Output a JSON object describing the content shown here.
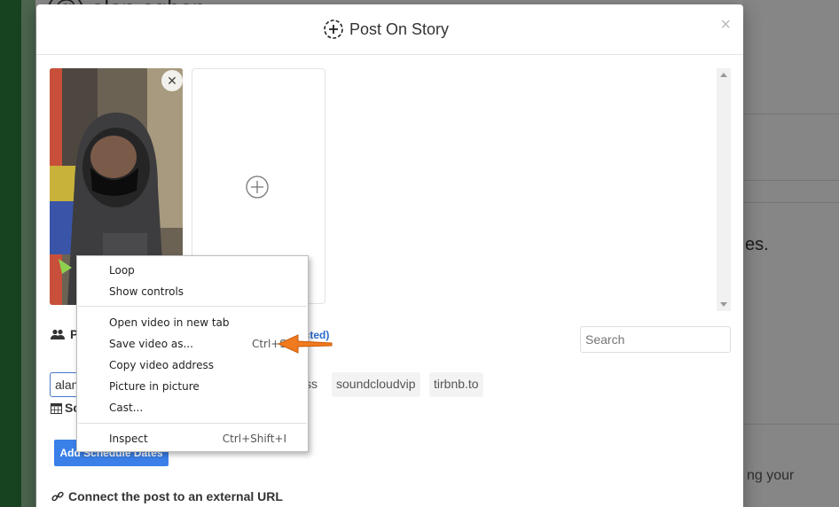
{
  "background": {
    "title_stub": "(@) alan eghap",
    "right_text_1": "es.",
    "right_text_2": "ng your"
  },
  "modal": {
    "title": "Post On Story",
    "close_glyph": "×"
  },
  "media": {
    "remove_glyph": "✕"
  },
  "profiles": {
    "label": "P",
    "selected_suffix": "ected)"
  },
  "search": {
    "placeholder": "Search"
  },
  "chips": {
    "active": "alan",
    "partial": "ss",
    "soundcloud": "soundcloudvip",
    "tirbnb": "tirbnb.to"
  },
  "schedule": {
    "label": "Sc",
    "button": "Add Schedule Dates"
  },
  "connect": {
    "label": "Connect the post to an external URL"
  },
  "context_menu": {
    "items": [
      {
        "label": "Loop",
        "shortcut": ""
      },
      {
        "label": "Show controls",
        "shortcut": ""
      },
      {
        "label": "Open video in new tab",
        "shortcut": ""
      },
      {
        "label": "Save video as...",
        "shortcut": "Ctrl+S"
      },
      {
        "label": "Copy video address",
        "shortcut": ""
      },
      {
        "label": "Picture in picture",
        "shortcut": ""
      },
      {
        "label": "Cast...",
        "shortcut": ""
      },
      {
        "label": "Inspect",
        "shortcut": "Ctrl+Shift+I"
      }
    ]
  },
  "colors": {
    "accent": "#3b7fe8",
    "arrow": "#f07a1e",
    "link": "#2a6ccf"
  }
}
